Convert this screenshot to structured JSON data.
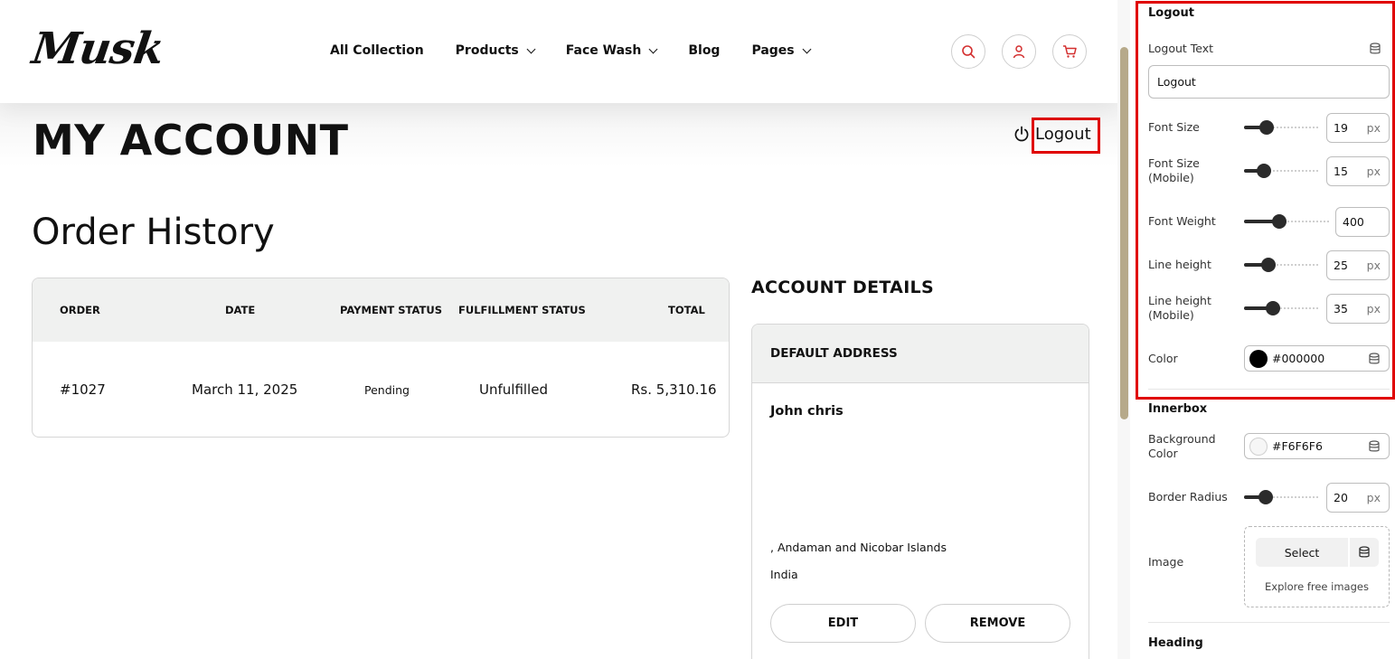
{
  "store": {
    "logo": "Musk",
    "nav": [
      {
        "label": "All Collection",
        "has_dropdown": false
      },
      {
        "label": "Products",
        "has_dropdown": true
      },
      {
        "label": "Face Wash",
        "has_dropdown": true
      },
      {
        "label": "Blog",
        "has_dropdown": false
      },
      {
        "label": "Pages",
        "has_dropdown": true
      }
    ],
    "header_icons": [
      "search-icon",
      "user-icon",
      "cart-icon"
    ],
    "accent_color": "#d32f2f"
  },
  "account": {
    "title": "MY ACCOUNT",
    "logout_label": "Logout",
    "order_history_title": "Order History",
    "orders_table": {
      "headers": [
        "ORDER",
        "DATE",
        "PAYMENT STATUS",
        "FULFILLMENT STATUS",
        "TOTAL"
      ],
      "rows": [
        [
          "#1027",
          "March 11, 2025",
          "Pending",
          "Unfulfilled",
          "Rs. 5,310.16"
        ]
      ]
    },
    "details_title": "ACCOUNT DETAILS",
    "address_card": {
      "header": "DEFAULT ADDRESS",
      "name": "John chris",
      "line1": ", Andaman and Nicobar Islands",
      "line2": "India",
      "edit_label": "EDIT",
      "remove_label": "REMOVE"
    }
  },
  "panel": {
    "logout_section": {
      "title": "Logout",
      "text_label": "Logout Text",
      "text_value": "Logout",
      "font_size": {
        "label": "Font Size",
        "value": "19",
        "unit": "px",
        "level": 0.25
      },
      "font_size_mobile": {
        "label": "Font Size (Mobile)",
        "value": "15",
        "unit": "px",
        "level": 0.2
      },
      "font_weight": {
        "label": "Font Weight",
        "value": "400",
        "level": 0.4
      },
      "line_height": {
        "label": "Line height",
        "value": "25",
        "unit": "px",
        "level": 0.28
      },
      "line_height_mobile": {
        "label": "Line height (Mobile)",
        "value": "35",
        "unit": "px",
        "level": 0.36
      },
      "color": {
        "label": "Color",
        "value": "#000000"
      }
    },
    "innerbox_section": {
      "title": "Innerbox",
      "background": {
        "label": "Background Color",
        "value": "#F6F6F6"
      },
      "border_radius": {
        "label": "Border Radius",
        "value": "20",
        "unit": "px",
        "level": 0.24
      },
      "image": {
        "label": "Image",
        "select_label": "Select",
        "explore_label": "Explore free images"
      }
    },
    "next_section_title": "Heading"
  },
  "highlight_color": "#e00000"
}
